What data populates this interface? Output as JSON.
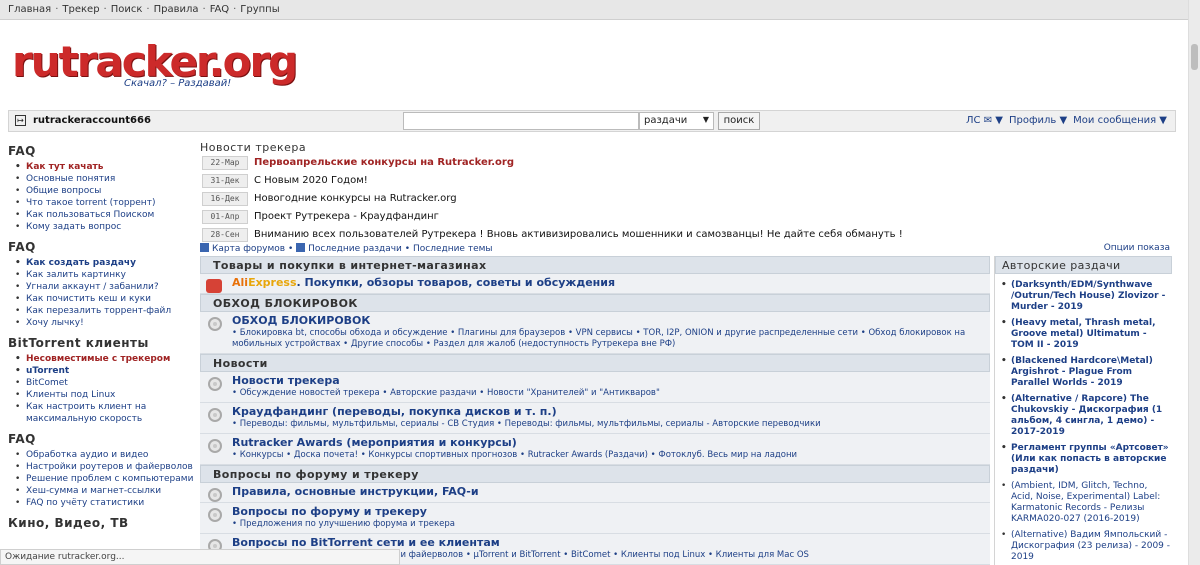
{
  "topnav": [
    "Главная",
    "Трекер",
    "Поиск",
    "Правила",
    "FAQ",
    "Группы"
  ],
  "logo": {
    "text": "rutracker.org",
    "slogan": "Скачал? – Раздавай!"
  },
  "userbar": {
    "username": "rutrackeraccount666",
    "search_scope": "раздачи",
    "search_button": "поиск",
    "menu": [
      "ЛС ✉ ▼",
      "Профиль ▼",
      "Мои сообщения ▼"
    ]
  },
  "sidebar": [
    {
      "title": "FAQ",
      "items": [
        {
          "label": "Как тут качать",
          "style": "hl"
        },
        {
          "label": "Основные понятия"
        },
        {
          "label": "Общие вопросы"
        },
        {
          "label": "Что такое torrent (торрент)"
        },
        {
          "label": "Как пользоваться Поиском"
        },
        {
          "label": "Кому задать вопрос"
        }
      ]
    },
    {
      "title": "FAQ",
      "items": [
        {
          "label": "Как создать раздачу",
          "style": "bd"
        },
        {
          "label": "Как залить картинку"
        },
        {
          "label": "Угнали аккаунт / забанили?"
        },
        {
          "label": "Как почистить кеш и куки"
        },
        {
          "label": "Как перезалить торрент-файл"
        },
        {
          "label": "Хочу лычку!"
        }
      ]
    },
    {
      "title": "BitTorrent клиенты",
      "items": [
        {
          "label": "Несовместимые с трекером",
          "style": "hl"
        },
        {
          "label": "uTorrent",
          "style": "bd"
        },
        {
          "label": "BitComet"
        },
        {
          "label": "Клиенты под Linux"
        },
        {
          "label": "Как настроить клиент на максимальную скорость"
        }
      ]
    },
    {
      "title": "FAQ",
      "items": [
        {
          "label": "Обработка аудио и видео"
        },
        {
          "label": "Настройки роутеров и файерволов"
        },
        {
          "label": "Решение проблем с компьютерами"
        },
        {
          "label": "Хеш-сумма и магнет-ссылки"
        },
        {
          "label": "FAQ по учёту статистики"
        }
      ]
    },
    {
      "title": "Кино, Видео, ТВ",
      "items": []
    }
  ],
  "news": {
    "title": "Новости трекера",
    "items": [
      {
        "date": "22-Мар",
        "text": "Первоапрельские конкурсы на Rutracker.org",
        "red": true
      },
      {
        "date": "31-Дек",
        "text": "С Новым 2020 Годом!"
      },
      {
        "date": "16-Дек",
        "text": "Новогодние конкурсы на Rutracker.org"
      },
      {
        "date": "01-Апр",
        "text": "Проект Рутрекера - Краудфандинг"
      },
      {
        "date": "28-Сен",
        "text": "Вниманию всех пользователей Рутрекера ! Вновь активизировались мошенники и самозванцы! Не дайте себя обмануть !"
      }
    ]
  },
  "forum_links": {
    "map": "Карта форумов",
    "latest_releases": "Последние раздачи",
    "latest_topics": "Последние темы",
    "options": "Опции показа"
  },
  "categories": [
    {
      "title": "Товары и покупки в интернет-магазинах",
      "forums": [
        {
          "aliexpress": true,
          "brand1": "Ali",
          "brand2": "Express",
          "title": ". Покупки, обзоры товаров, советы и обсуждения",
          "subs": ""
        }
      ]
    },
    {
      "title": "ОБХОД БЛОКИРОВОК",
      "forums": [
        {
          "title": "ОБХОД БЛОКИРОВОК",
          "subs": "• Блокировка bt, способы обхода и обсуждение • Плагины для браузеров • VPN сервисы • TOR, I2P, ONION и другие распределенные сети • Обход блокировок на мобильных устройствах • Другие способы • Раздел для жалоб (недоступность Рутрекера вне РФ)"
        }
      ]
    },
    {
      "title": "Новости",
      "forums": [
        {
          "title": "Новости трекера",
          "subs": "• Обсуждение новостей трекера • Авторские раздачи • Новости \"Хранителей\" и \"Антикваров\""
        },
        {
          "title": "Краудфандинг (переводы, покупка дисков и т. п.)",
          "subs": "• Переводы: фильмы, мультфильмы, сериалы - СВ Студия • Переводы: фильмы, мультфильмы, сериалы - Авторские переводчики"
        },
        {
          "title": "Rutracker Awards (мероприятия и конкурсы)",
          "subs": "• Конкурсы • Доска почета! • Конкурсы спортивных прогнозов • Rutracker Awards (Раздачи) • Фотоклуб. Весь мир на ладони"
        }
      ]
    },
    {
      "title": "Вопросы по форуму и трекеру",
      "forums": [
        {
          "title": "Правила, основные инструкции, FAQ-и",
          "subs": ""
        },
        {
          "title": "Вопросы по форуму и трекеру",
          "subs": "• Предложения по улучшению форума и трекера"
        },
        {
          "title": "Вопросы по BitTorrent сети и ее клиентам",
          "subs": "к и отдачи • Настройка антивирусов и файерволов • µTorrent и BitTorrent • BitComet • Клиенты под Linux • Клиенты для Mac OS"
        }
      ]
    }
  ],
  "author_releases": {
    "title": "Авторские раздачи",
    "items": [
      {
        "text": "(Darksynth/EDM/Synthwave /Outrun/Tech House) Zlovizor - Murder - 2019",
        "bold": true
      },
      {
        "text": "(Heavy metal, Thrash metal, Groove metal) Ultimatum - TOM II - 2019",
        "bold": true
      },
      {
        "text": "(Blackened Hardcore\\Metal) Argishrot - Plague From Parallel Worlds - 2019",
        "bold": true
      },
      {
        "text": "(Alternative / Rapcore) The Chukovskiy - Дискография (1 альбом, 4 сингла, 1 демо) - 2017-2019",
        "bold": true
      },
      {
        "text": "Регламент группы «Артсовет» (Или как попасть в авторские раздачи)",
        "bold": true
      },
      {
        "text": "(Ambient, IDM, Glitch, Techno, Acid, Noise, Experimental) Label: Karmatonic Records - Релизы KARMA020-027 (2016-2019)"
      },
      {
        "text": "(Alternative) Вадим Ямпольский - Дискография (23 релиза) - 2009 - 2019"
      }
    ]
  },
  "status_bar": "Ожидание rutracker.org..."
}
